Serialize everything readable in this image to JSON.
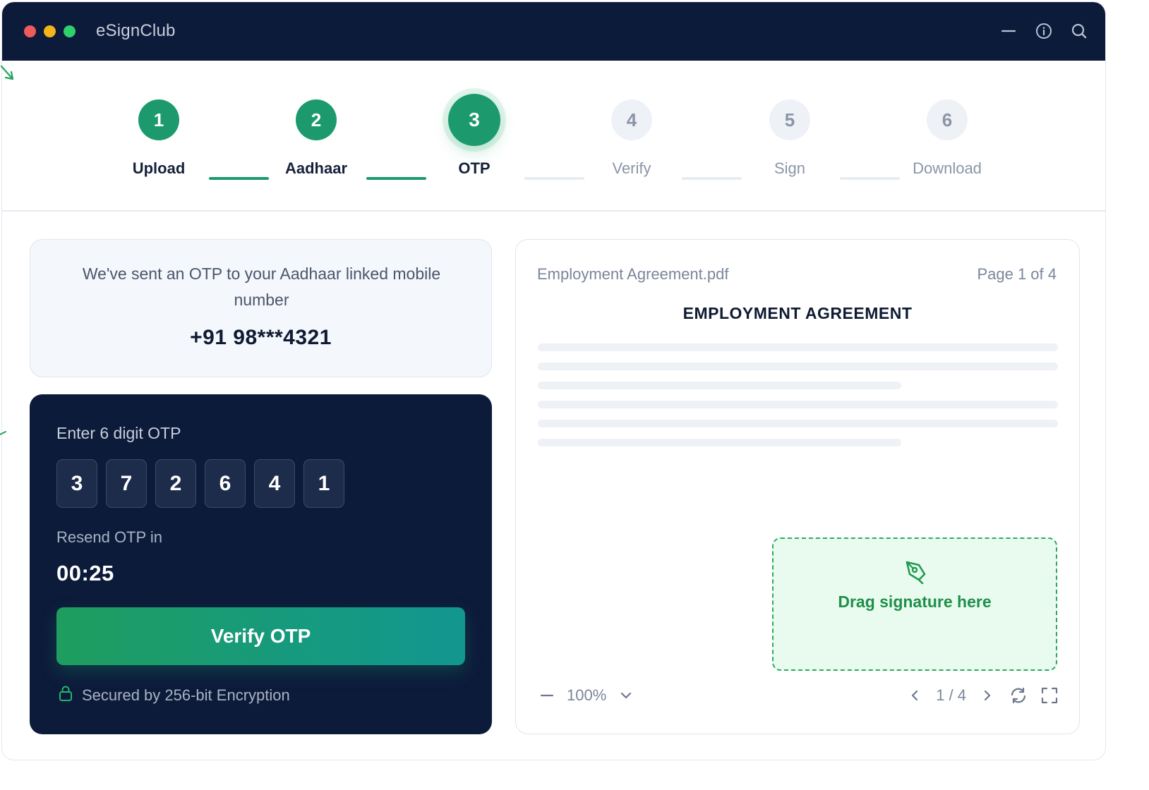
{
  "window": {
    "title": "eSignClub",
    "traffic_lights": [
      "#ef5b5b",
      "#f3b51a",
      "#2fcf6b"
    ],
    "icons": [
      "minimize-icon",
      "info-icon",
      "search-icon"
    ]
  },
  "stepper": {
    "steps": [
      {
        "number": "1",
        "label": "Upload",
        "state": "done"
      },
      {
        "number": "2",
        "label": "Aadhaar",
        "state": "done"
      },
      {
        "number": "3",
        "label": "OTP",
        "state": "active"
      },
      {
        "number": "4",
        "label": "Verify",
        "state": "todo"
      },
      {
        "number": "5",
        "label": "Sign",
        "state": "todo"
      },
      {
        "number": "6",
        "label": "Download",
        "state": "todo"
      }
    ]
  },
  "otp_info": {
    "message": "We've sent an OTP to your Aadhaar linked mobile number",
    "phone": "+91 98***4321"
  },
  "otp_entry": {
    "label": "Enter 6 digit OTP",
    "digits": [
      "3",
      "7",
      "2",
      "6",
      "4",
      "1"
    ],
    "resend_label": "Resend OTP in",
    "timer": "00:25",
    "verify_button": "Verify OTP",
    "secure_text": "Secured by 256-bit Encryption"
  },
  "document": {
    "file_name": "Employment Agreement.pdf",
    "page_indicator": "Page 1 of 4",
    "title": "EMPLOYMENT AGREEMENT",
    "signature_zone": "Drag signature here",
    "zoom": "100%",
    "pager": "1 / 4"
  },
  "colors": {
    "navy": "#0d1b3a",
    "accent_green": "#1c9a6e",
    "signature_green": "#1f8f4a"
  }
}
